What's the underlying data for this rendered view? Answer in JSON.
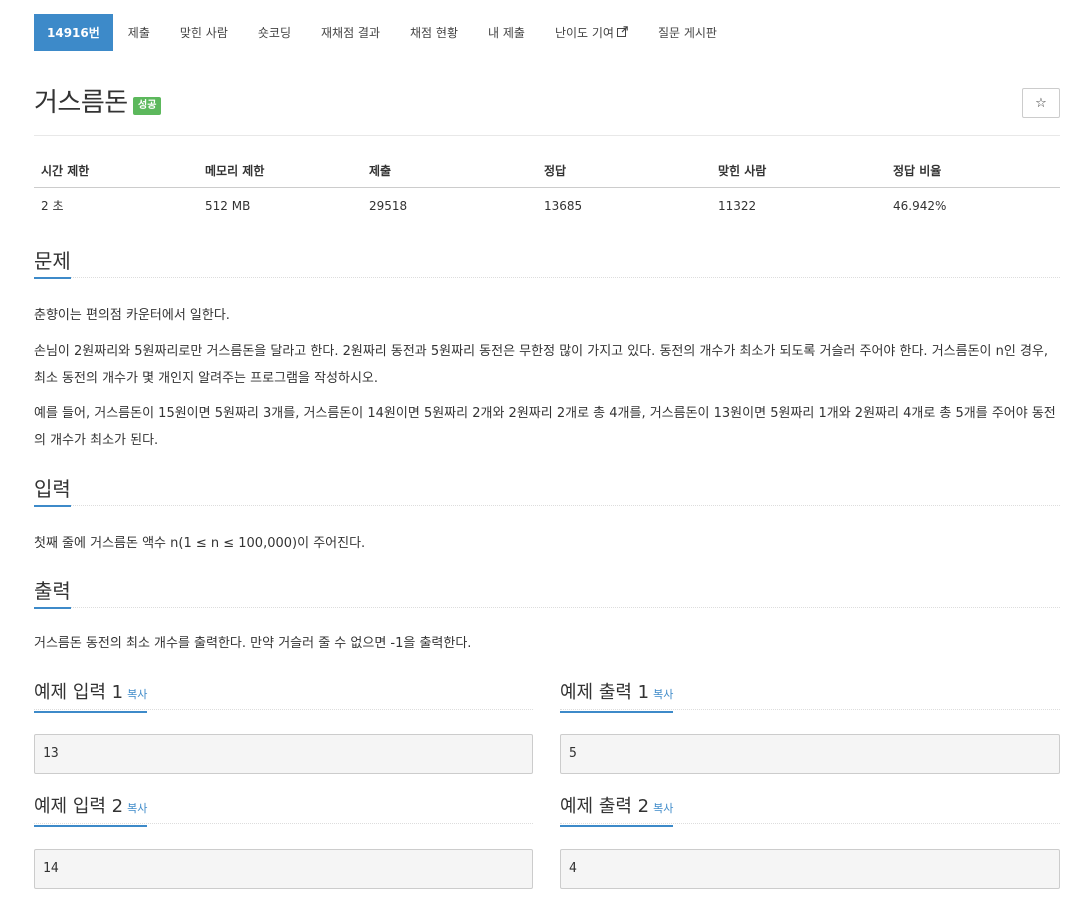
{
  "tabs": [
    {
      "label": "14916번",
      "active": true
    },
    {
      "label": "제출"
    },
    {
      "label": "맞힌 사람"
    },
    {
      "label": "숏코딩"
    },
    {
      "label": "재채점 결과"
    },
    {
      "label": "채점 현황"
    },
    {
      "label": "내 제출"
    },
    {
      "label": "난이도 기여"
    },
    {
      "label": "질문 게시판"
    }
  ],
  "problem": {
    "title": "거스름돈",
    "badge": "성공",
    "star_icon": "☆"
  },
  "info": {
    "headers": [
      "시간 제한",
      "메모리 제한",
      "제출",
      "정답",
      "맞힌 사람",
      "정답 비율"
    ],
    "values": [
      "2 초",
      "512 MB",
      "29518",
      "13685",
      "11322",
      "46.942%"
    ]
  },
  "sections": {
    "description_title": "문제",
    "description": [
      "춘향이는 편의점 카운터에서 일한다.",
      "손님이 2원짜리와 5원짜리로만 거스름돈을 달라고 한다. 2원짜리 동전과 5원짜리 동전은 무한정 많이 가지고 있다. 동전의 개수가 최소가 되도록 거슬러 주어야 한다. 거스름돈이 n인 경우, 최소 동전의 개수가 몇 개인지 알려주는 프로그램을 작성하시오.",
      "예를 들어, 거스름돈이 15원이면 5원짜리 3개를, 거스름돈이 14원이면 5원짜리 2개와 2원짜리 2개로 총 4개를, 거스름돈이 13원이면 5원짜리 1개와 2원짜리 4개로 총 5개를 주어야 동전의 개수가 최소가 된다."
    ],
    "input_title": "입력",
    "input": "첫째 줄에 거스름돈 액수 n(1 ≤ n ≤ 100,000)이 주어진다.",
    "output_title": "출력",
    "output": "거스름돈 동전의 최소 개수를 출력한다. 만약 거슬러 줄 수 없으면 -1을 출력한다."
  },
  "samples": {
    "copy_label": "복사",
    "in1_title": "예제 입력 1",
    "in1": "13",
    "out1_title": "예제 출력 1",
    "out1": "5",
    "in2_title": "예제 입력 2",
    "in2": "14",
    "out2_title": "예제 출력 2",
    "out2": "4"
  }
}
